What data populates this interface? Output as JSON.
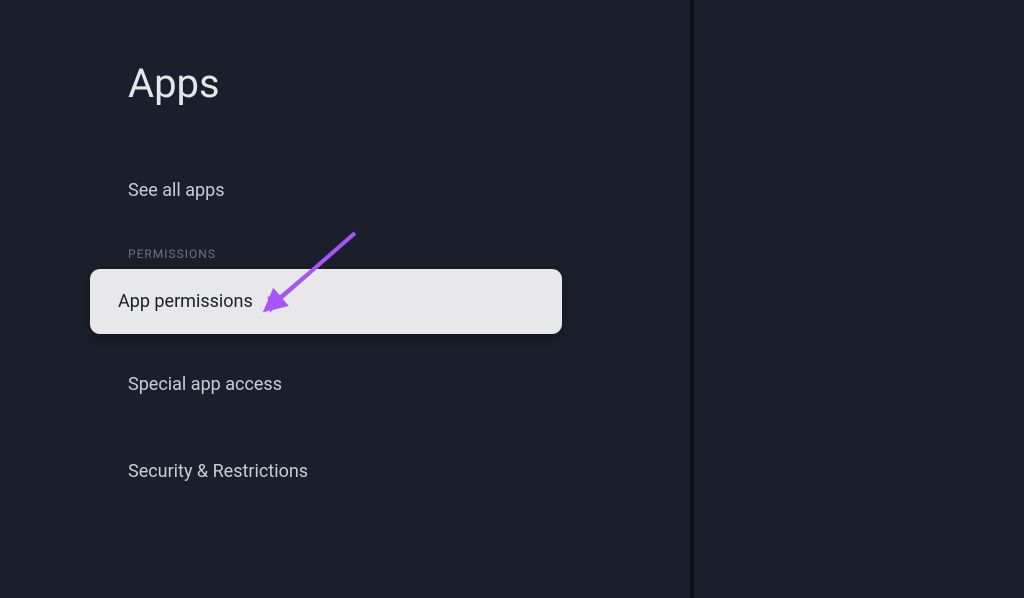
{
  "page": {
    "title": "Apps"
  },
  "menu": {
    "see_all_apps": "See all apps",
    "section_permissions": "PERMISSIONS",
    "app_permissions": "App permissions",
    "special_app_access": "Special app access",
    "security_restrictions": "Security & Restrictions"
  },
  "annotation": {
    "arrow_color": "#a855f7"
  }
}
